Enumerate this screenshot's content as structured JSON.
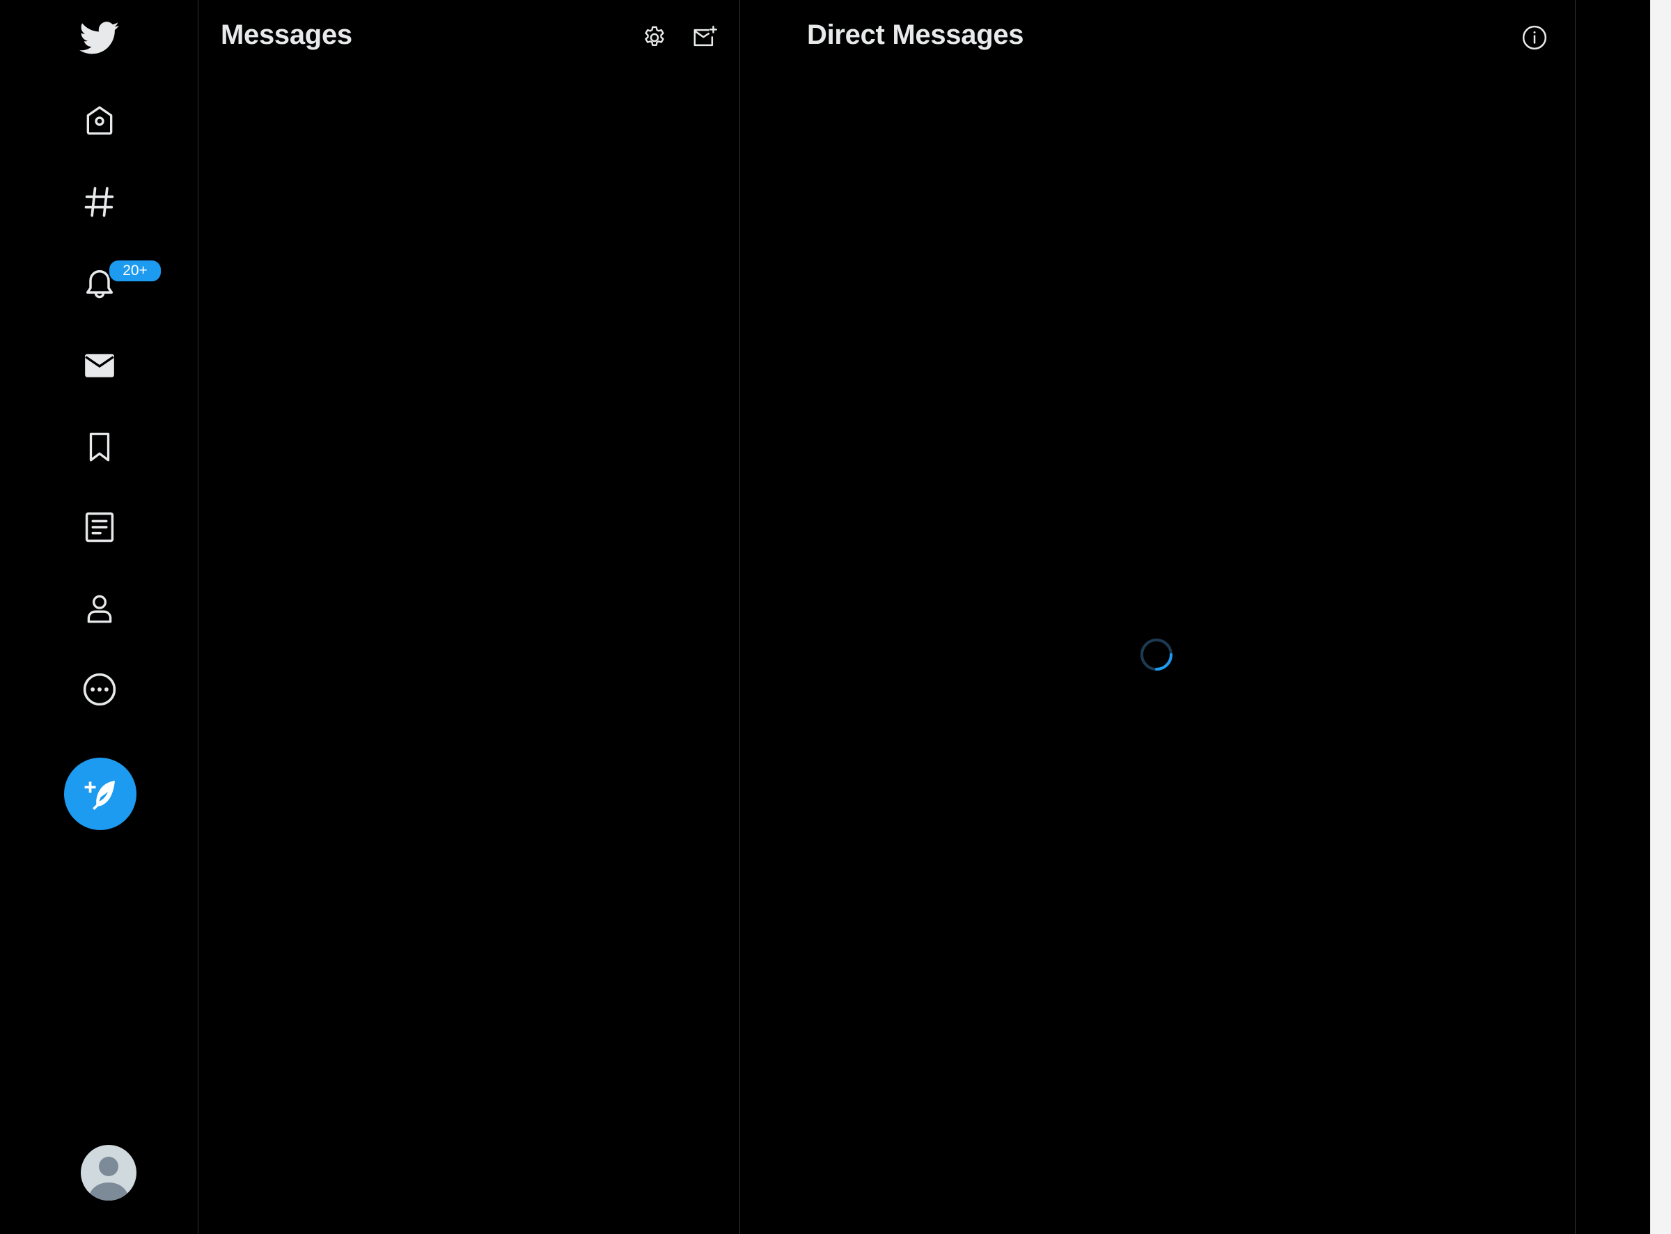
{
  "theme": {
    "background": "#000000",
    "accent": "#1d9bf0",
    "text": "#e7e9ea",
    "divider": "#2f3336"
  },
  "sidebar": {
    "logo_icon": "twitter-bird-icon",
    "items": [
      {
        "name": "home",
        "icon": "home-icon"
      },
      {
        "name": "explore",
        "icon": "hashtag-icon"
      },
      {
        "name": "notifications",
        "icon": "bell-icon",
        "badge": "20+"
      },
      {
        "name": "messages",
        "icon": "envelope-icon",
        "active": true
      },
      {
        "name": "bookmarks",
        "icon": "bookmark-icon"
      },
      {
        "name": "lists",
        "icon": "list-icon"
      },
      {
        "name": "profile",
        "icon": "person-icon"
      },
      {
        "name": "more",
        "icon": "more-circle-icon"
      }
    ],
    "compose_icon": "compose-tweet-icon",
    "avatar_icon": "default-avatar-icon"
  },
  "messages": {
    "title": "Messages",
    "settings_icon": "gear-icon",
    "new_message_icon": "new-message-icon"
  },
  "direct_messages": {
    "title": "Direct Messages",
    "info_icon": "info-icon",
    "loading_icon": "loading-spinner-icon"
  }
}
